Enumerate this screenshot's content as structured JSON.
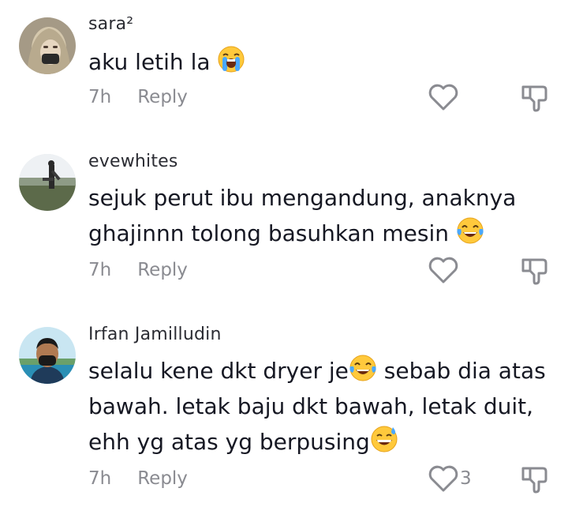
{
  "comments": [
    {
      "username": "sara²",
      "text_lines": [
        "aku letih la"
      ],
      "emoji": [
        "loudly-crying-face"
      ],
      "time": "7h",
      "reply_label": "Reply",
      "like_count": ""
    },
    {
      "username": "evewhites",
      "text_lines": [
        "sejuk perut ibu mengandung, anaknya",
        "ghajinnn tolong basuhkan mesin"
      ],
      "emoji": [
        "face-with-tears-of-joy"
      ],
      "time": "7h",
      "reply_label": "Reply",
      "like_count": ""
    },
    {
      "username": "Irfan Jamilludin",
      "text_line1_a": "selalu kene dkt dryer je",
      "text_line1_b": " sebab dia atas",
      "text_line2": "bawah. letak baju dkt bawah, letak duit,",
      "text_line3": "ehh yg atas yg berpusing",
      "emoji": [
        "face-with-tears-of-joy",
        "grinning-face-with-sweat"
      ],
      "time": "7h",
      "reply_label": "Reply",
      "like_count": "3"
    }
  ],
  "colors": {
    "text": "#161823",
    "muted": "#8a8b91",
    "background": "#ffffff"
  }
}
